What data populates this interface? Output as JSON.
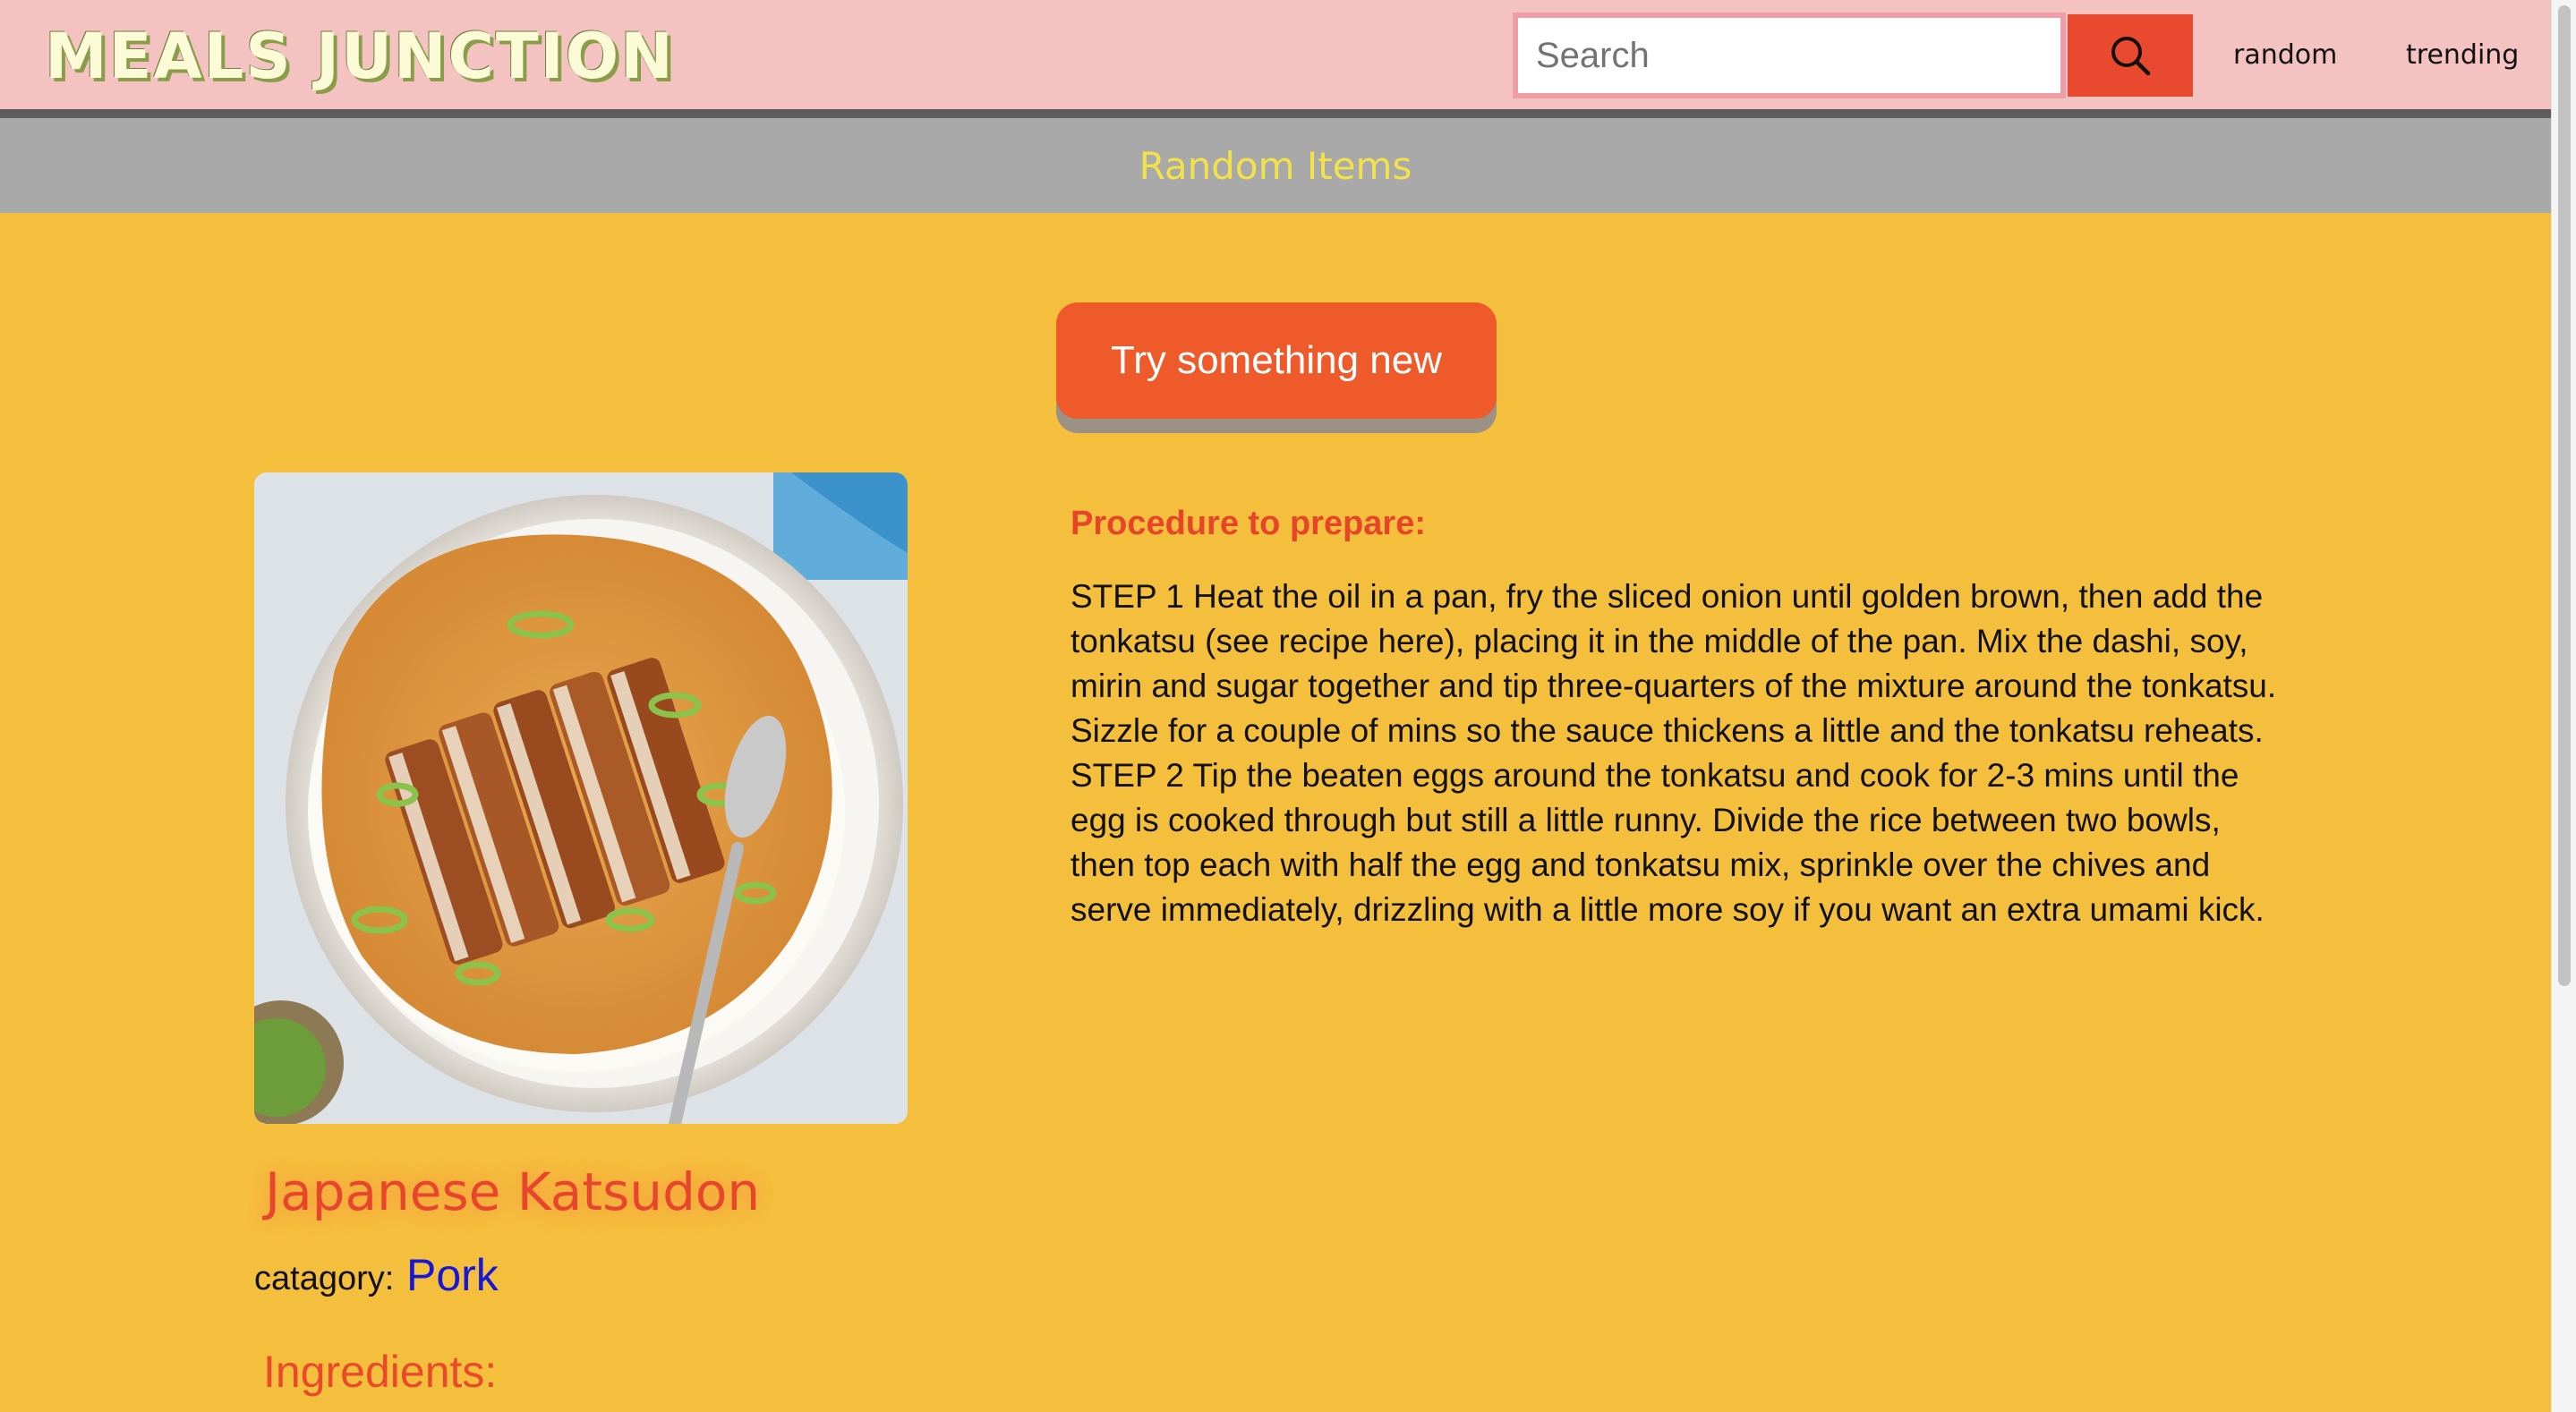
{
  "header": {
    "logo": "MEALS JUNCTION",
    "search": {
      "placeholder": "Search",
      "value": ""
    },
    "nav": {
      "random": "random",
      "trending": "trending"
    }
  },
  "banner": {
    "title": "Random Items"
  },
  "actions": {
    "try_label": "Try something new"
  },
  "meal": {
    "title": "Japanese Katsudon",
    "category_label": "catagory:",
    "category_value": "Pork",
    "ingredients_heading": "Ingredients:",
    "procedure_heading": "Procedure to prepare:",
    "procedure_text": "STEP 1 Heat the oil in a pan, fry the sliced onion until golden brown, then add the tonkatsu (see recipe here), placing it in the middle of the pan. Mix the dashi, soy, mirin and sugar together and tip three-quarters of the mixture around the tonkatsu. Sizzle for a couple of mins so the sauce thickens a little and the tonkatsu reheats. STEP 2 Tip the beaten eggs around the tonkatsu and cook for 2-3 mins until the egg is cooked through but still a little runny. Divide the rice between two bowls, then top each with half the egg and tonkatsu mix, sprinkle over the chives and serve immediately, drizzling with a little more soy if you want an extra umami kick."
  },
  "icons": {
    "search": "search-icon"
  },
  "colors": {
    "navbar": "#f5c2c2",
    "background": "#f5bf3e",
    "banner": "#a9a9a9",
    "accent": "#ee5a2a",
    "search_button": "#e94a2f",
    "link": "#1717d6"
  }
}
